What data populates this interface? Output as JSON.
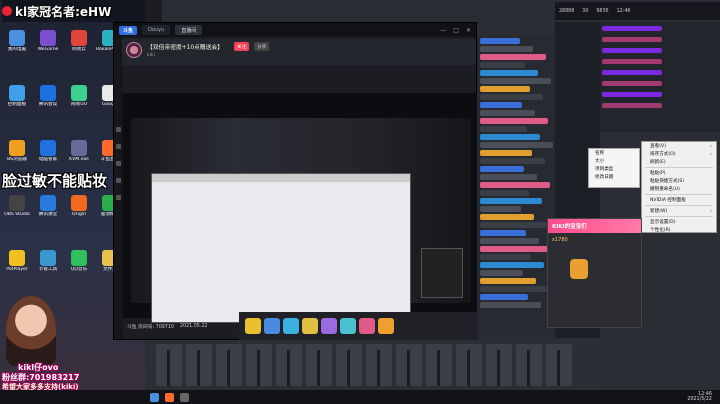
{
  "stream_overlay": {
    "title": "kl家冠名者:eHW",
    "subtitle": "脸过敏不能贴妆"
  },
  "desktop": {
    "icons": [
      {
        "label": "我的电脑",
        "color": "#4a8fe0"
      },
      {
        "label": "WeGame",
        "color": "#7a4fd0"
      },
      {
        "label": "网易云",
        "color": "#e0433a"
      },
      {
        "label": "RoxanPlayer",
        "color": "#2ab0c0"
      },
      {
        "label": "控制面板",
        "color": "#3da0e8"
      },
      {
        "label": "腾讯会议",
        "color": "#1e6fe0"
      },
      {
        "label": "网易UU",
        "color": "#3ccf8e"
      },
      {
        "label": "Google",
        "color": "#eaeaea"
      },
      {
        "label": "BS浏览器",
        "color": "#f0a020"
      },
      {
        "label": "电脑管家",
        "color": "#2070e0"
      },
      {
        "label": "KVM.exe",
        "color": "#6a6a9a"
      },
      {
        "label": "斗鱼直播",
        "color": "#ff6a2a"
      },
      {
        "label": "OBS Studio",
        "color": "#444"
      },
      {
        "label": "腾讯课堂",
        "color": "#2a7ae0"
      },
      {
        "label": "Origin",
        "color": "#f06a20"
      },
      {
        "label": "驱动精灵",
        "color": "#2ab04a"
      },
      {
        "label": "PotPlayer",
        "color": "#f0c020"
      },
      {
        "label": "节省工具",
        "color": "#3a9ad0"
      },
      {
        "label": "QQ音乐",
        "color": "#30c060"
      },
      {
        "label": "文件夹",
        "color": "#e8c050"
      }
    ]
  },
  "streamer_panel": {
    "fan_group": "粉丝群:701983217",
    "nickname": "kikl仔ovo",
    "bottom_text": "希望大家多多支持(kiki)"
  },
  "app": {
    "tabs": [
      "Douyu",
      "直播间"
    ],
    "room": {
      "title": "【双倍亲密度+10点赠送会】",
      "host": "kiki",
      "follow_label": "关注",
      "share_label": "分享"
    },
    "video_bar": {
      "room_id_label": "斗鱼 房间号: 709710",
      "date": "2021.05.22"
    },
    "gifts": [
      {
        "color": "#e8c030"
      },
      {
        "color": "#4a8ae0"
      },
      {
        "color": "#3ab0e0"
      },
      {
        "color": "#e0c040"
      },
      {
        "color": "#9a6ae0"
      },
      {
        "color": "#4ac0d0"
      },
      {
        "color": "#e05a8a"
      },
      {
        "color": "#f0a030"
      }
    ]
  },
  "context_menu": {
    "items": [
      "查看(V)",
      "排序方式(O)",
      "刷新(E)",
      "粘贴(P)",
      "粘贴快捷方式(S)",
      "撤销重命名(U)",
      "NVIDIA 控制面板",
      "新建(W)",
      "显示设置(D)",
      "个性化(R)"
    ]
  },
  "sub_menu": {
    "items": [
      "名称",
      "大小",
      "项目类型",
      "修改日期"
    ]
  },
  "gift_popup": {
    "banner": "KIKI的宝宝们",
    "count": "x1780"
  },
  "top_right": {
    "items": [
      "28888",
      "30",
      "9836",
      "12:46"
    ]
  },
  "taskbar": {
    "time": "12:46",
    "date": "2021/5/22"
  }
}
